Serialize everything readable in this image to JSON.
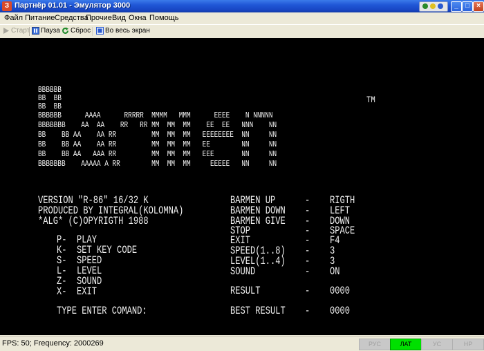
{
  "window": {
    "title": "Партнёр 01.01 - Эмулятор 3000",
    "app_icon_letter": "З",
    "buttons": {
      "minimize": "_",
      "maximize": "□",
      "close": "×"
    }
  },
  "menu": {
    "items": [
      "Файл",
      "Питание",
      "Средства",
      "Прочие",
      "Вид",
      "Окна",
      "Помощь"
    ]
  },
  "toolbar": {
    "start": "Старт",
    "pause": "Пауза",
    "reset": "Сброс",
    "fullscreen": "Во весь экран"
  },
  "screen": {
    "logo": {
      "tm": "TM",
      "rows": [
        "BBBBBB",
        "BB  BB",
        "BB  BB",
        "BBBBBB      AAAA      RRRRR  MMMM   MMM      EEEE    N NNNNN",
        "BBBBBBB    AA  AA    RR   RR MM  MM  MM    EE  EE   NNN    NN",
        "BB    BB AA    AA RR         MM  MM  MM   EEEEEEEE  NN     NN",
        "BB    BB AA    AA RR         MM  MM  MM   EE        NN     NN",
        "BB    BB AA   AAA RR         MM  MM  MM   EEE       NN     NN",
        "BBBBBBB    AAAAA A RR        MM  MM  MM     EEEEE   NN     NN"
      ]
    },
    "left_lines": [
      "VERSION \"R-86\" 16/32 K",
      "PRODUCED BY INTEGRAL(KOLOMNA)",
      "*ALG* (C)OPYRIGTH 1988"
    ],
    "commands": [
      "P-  PLAY",
      "K-  SET KEY CODE",
      "S-  SPEED",
      "L-  LEVEL",
      "Z-  SOUND",
      "X-  EXIT"
    ],
    "prompt": "TYPE ENTER COMAND:",
    "settings": [
      {
        "key": "BARMEN UP",
        "dash": "-",
        "value": "RIGTH"
      },
      {
        "key": "BARMEN DOWN",
        "dash": "-",
        "value": "LEFT"
      },
      {
        "key": "BARMEN GIVE",
        "dash": "-",
        "value": "DOWN"
      },
      {
        "key": "STOP",
        "dash": "-",
        "value": "SPACE"
      },
      {
        "key": "EXIT",
        "dash": "-",
        "value": "F4"
      },
      {
        "key": "SPEED(1..8)",
        "dash": "-",
        "value": "3"
      },
      {
        "key": "LEVEL(1..4)",
        "dash": "-",
        "value": "3"
      },
      {
        "key": "SOUND",
        "dash": "-",
        "value": "ON"
      }
    ],
    "result": {
      "label": "RESULT",
      "dash": "-",
      "value": "0000"
    },
    "best_result": {
      "label": "BEST RESULT",
      "dash": "-",
      "value": "0000"
    }
  },
  "status": {
    "text": "FPS: 50; Frequency: 2000269",
    "indicators": [
      {
        "label": "РУС",
        "active": false
      },
      {
        "label": "ЛАТ",
        "active": true
      },
      {
        "label": "УС",
        "active": false
      },
      {
        "label": "НР",
        "active": false
      }
    ]
  },
  "colors": {
    "screen_bg": "#000000",
    "screen_fg": "#f2f2f2",
    "indicator_active": "#00e000",
    "titlebar": "#1f57d6"
  }
}
